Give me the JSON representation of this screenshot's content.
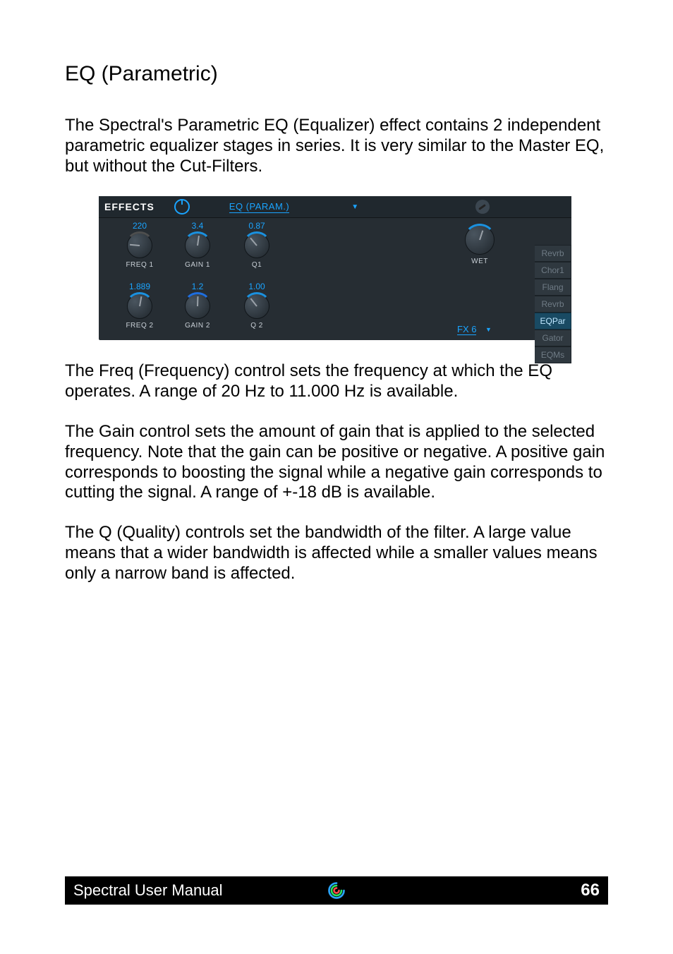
{
  "title": "EQ (Parametric)",
  "paragraphs": {
    "p1": "The Spectral's Parametric EQ (Equalizer) effect contains 2 independent parametric equalizer stages in series. It is very similar to the Master EQ, but without the Cut-Filters.",
    "p2": "The Freq (Frequency) control sets the frequency at which the EQ operates. A range of 20 Hz to 11.000 Hz is available.",
    "p3": "The Gain control sets the amount of gain that is applied to the selected frequency. Note that the gain can be positive or negative. A positive gain corresponds to boosting the signal while a negative gain corresponds to cutting the signal. A range of +-18 dB is available.",
    "p4": "The Q (Quality) controls set the bandwidth of the filter. A large value means that a wider bandwidth is affected while a smaller values means only a narrow band is affected."
  },
  "panel": {
    "header": {
      "effects": "EFFECTS",
      "dropdown": "EQ (PARAM.)"
    },
    "knobs": {
      "freq1": {
        "value": "220",
        "label": "FREQ 1"
      },
      "gain1": {
        "value": "3.4",
        "label": "GAIN 1"
      },
      "q1": {
        "value": "0.87",
        "label": "Q1"
      },
      "freq2": {
        "value": "1.889",
        "label": "FREQ 2"
      },
      "gain2": {
        "value": "1.2",
        "label": "GAIN 2"
      },
      "q2": {
        "value": "1.00",
        "label": "Q 2"
      },
      "wet": {
        "label": "WET"
      }
    },
    "fx_select": "FX 6",
    "tabs": {
      "t1": "Revrb",
      "t2": "Chor1",
      "t3": "Flang",
      "t4": "Revrb",
      "t5": "EQPar",
      "t6": "Gator",
      "t7": "EQMs"
    }
  },
  "footer": {
    "title": "Spectral User Manual",
    "page": "66"
  }
}
